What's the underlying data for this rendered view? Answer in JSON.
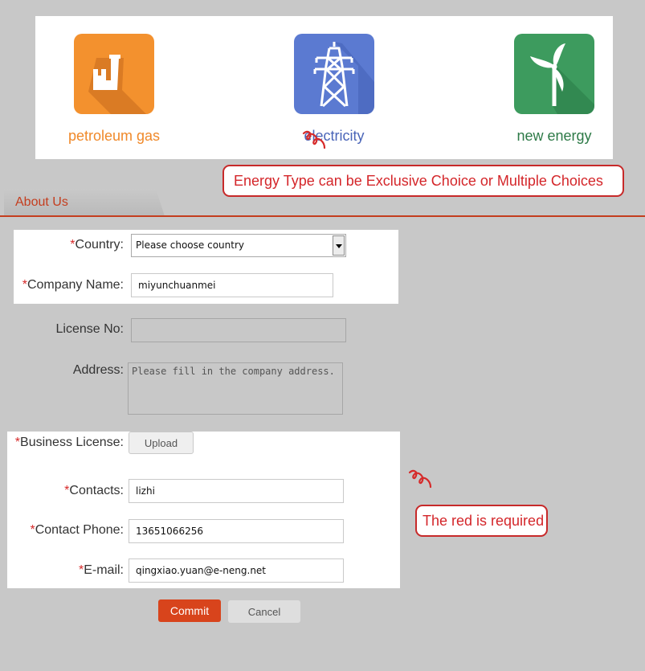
{
  "energy_types": [
    {
      "label": "petroleum gas",
      "icon": "factory-icon",
      "color": "#f3912e"
    },
    {
      "label": "electricity",
      "icon": "power-tower-icon",
      "color": "#5b7ad1"
    },
    {
      "label": "new energy",
      "icon": "wind-turbine-icon",
      "color": "#3d9b5e"
    }
  ],
  "callouts": {
    "energy_type": "Energy Type can be Exclusive Choice or Multiple Choices",
    "required": "The red is required"
  },
  "section": {
    "tab_label": "About Us"
  },
  "form": {
    "required_mark": "*",
    "country": {
      "label": "Country:",
      "value": "Please choose country"
    },
    "company_name": {
      "label": "Company Name:",
      "value": "miyunchuanmei"
    },
    "license_no": {
      "label": "License No:",
      "value": ""
    },
    "address": {
      "label": "Address:",
      "placeholder": "Please fill in the company address."
    },
    "business_license": {
      "label": "Business License:",
      "button": "Upload"
    },
    "contacts": {
      "label": "Contacts:",
      "value": "lizhi"
    },
    "contact_phone": {
      "label": "Contact Phone:",
      "value": "13651066256"
    },
    "email": {
      "label": "E-mail:",
      "value": "qingxiao.yuan@e-neng.net"
    }
  },
  "actions": {
    "commit": "Commit",
    "cancel": "Cancel"
  },
  "colors": {
    "accent": "#c43d1e",
    "required": "#d62a2a",
    "commit": "#d8441c"
  }
}
